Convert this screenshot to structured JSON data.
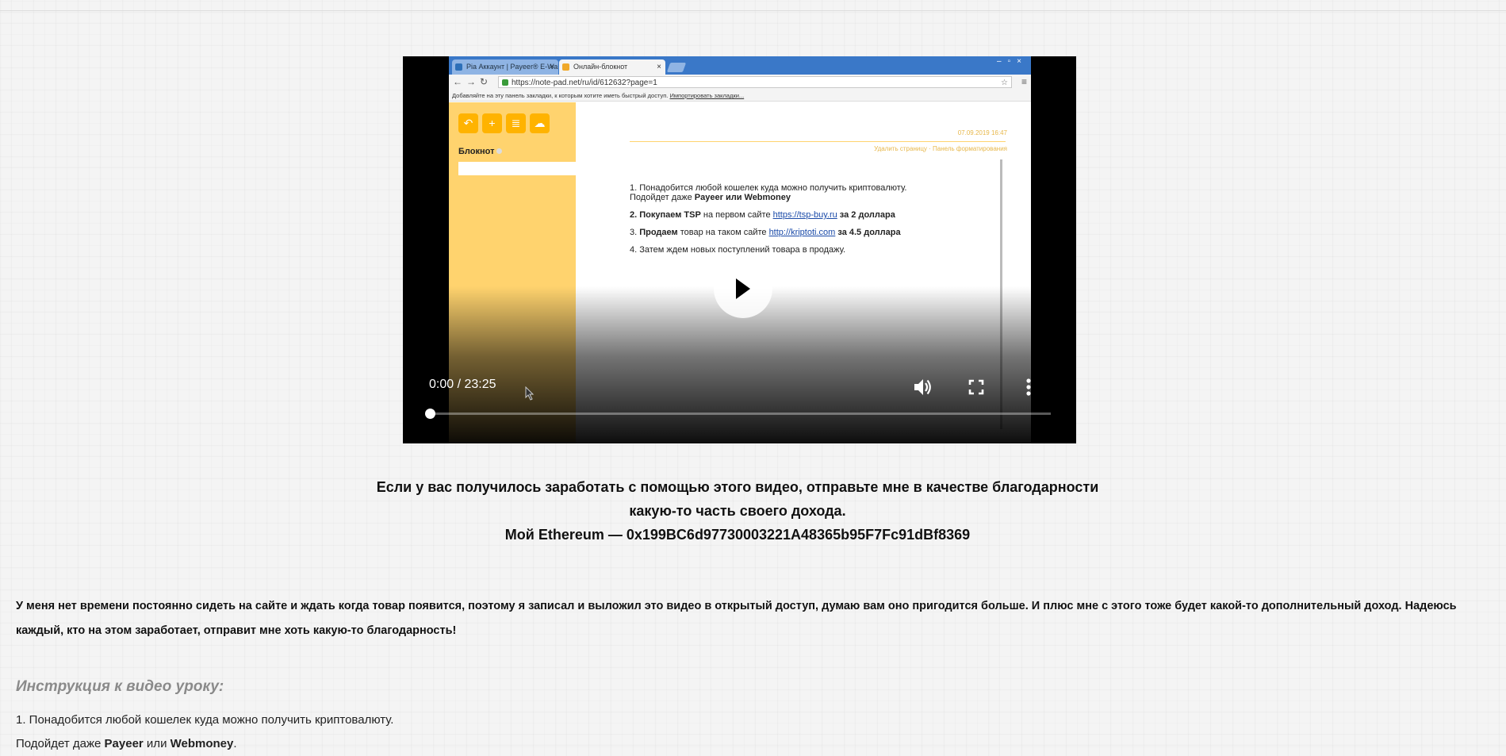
{
  "video": {
    "browser": {
      "tab1_title": "Pia Аккаунт | Payeer® E-Walle",
      "tab2_title": "Онлайн-блокнот",
      "tab_close": "×",
      "address": "https://note-pad.net/ru/id/612632?page=1",
      "bookmarks_hint": "Добавляйте на эту панель закладки, к которым хотите иметь быстрый доступ.",
      "bookmarks_import": "Импортировать закладки..."
    },
    "notepad": {
      "title": "Блокнот",
      "date": "07.09.2019 16:47",
      "links": "Удалить страницу · Панель форматирования",
      "line1": "1. Понадобится любой кошелек куда можно получить криптовалюту.",
      "line1b_pre": "Подойдет даже ",
      "line1b_bold": "Payeer или Webmoney",
      "line2_bold": "2. Покупаем TSP",
      "line2_mid": " на первом сайте ",
      "line2_link": "https://tsp-buy.ru",
      "line2_end": " за 2 доллара",
      "line3_pre": "3. ",
      "line3_bold": "Продаем",
      "line3_mid": " товар на таком сайте ",
      "line3_link": "http://kriptoti.com",
      "line3_end": " за 4.5 доллара",
      "line4": "4. Затем ждем новых поступлений товара в продажу."
    },
    "time": "0:00 / 23:25",
    "progress": 0
  },
  "message": {
    "line1": "Если у вас получилось заработать с помощью этого видео, отправьте мне в качестве благодарности",
    "line2": "какую-то часть своего дохода.",
    "line3": "Мой Ethereum — 0x199BC6d97730003221A48365b95F7Fc91dBf8369"
  },
  "paragraph": "У меня нет времени постоянно сидеть на сайте и ждать когда товар появится, поэтому я записал и выложил это видео в открытый доступ, думаю вам оно пригодится больше. И плюс мне с этого тоже будет какой-то дополнительный доход.  Надеюсь каждый, кто на этом заработает, отправит мне хоть какую-то благодарность!",
  "instructions": {
    "heading": "Инструкция к видео уроку:",
    "step1": "1. Понадобится любой кошелек куда можно получить криптовалюту.",
    "step1b_pre": "Подойдет даже ",
    "step1b_bold1": "Payeer",
    "step1b_mid": " или ",
    "step1b_bold2": "Webmoney",
    "step1b_end": "."
  },
  "colors": {
    "accent": "#ffb300",
    "sidebar": "#ffd36e",
    "link": "#1a4aa8"
  }
}
